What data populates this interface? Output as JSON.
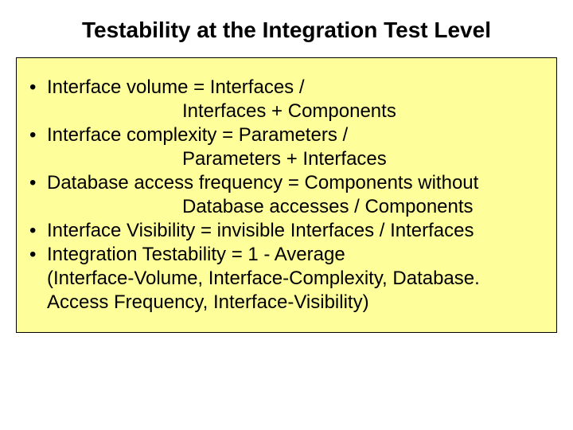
{
  "title": "Testability at the Integration Test Level",
  "bullets": {
    "b1a": "Interface volume = Interfaces /",
    "b1b": "Interfaces + Components",
    "b2a": "Interface complexity = Parameters /",
    "b2b": "Parameters + Interfaces",
    "b3a": "Database access frequency = Components  without",
    "b3b": "Database accesses / Components",
    "b4": "Interface Visibility = invisible Interfaces / Interfaces",
    "b5a": "Integration Testability = 1 - Average",
    "b5b": "(Interface-Volume, Interface-Complexity, Database.",
    "b5c": "Access Frequency, Interface-Visibility)"
  }
}
